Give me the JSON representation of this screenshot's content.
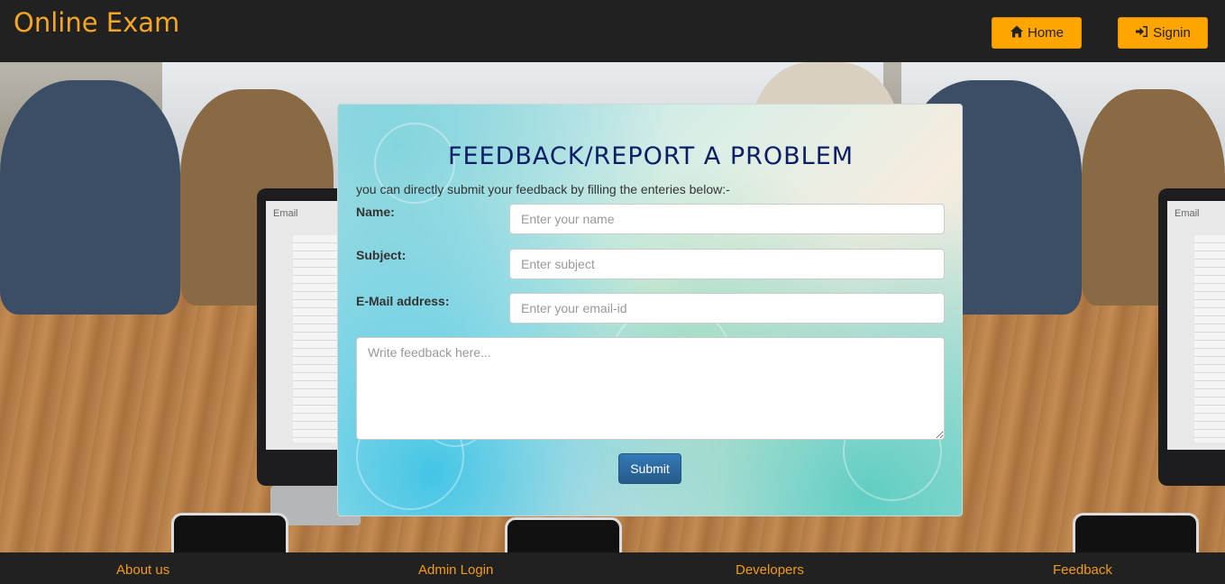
{
  "header": {
    "brand": "Online Exam",
    "home_label": "Home",
    "signin_label": "Signin"
  },
  "form": {
    "title": "FEEDBACK/REPORT A PROBLEM",
    "subtitle": "you can directly submit your feedback by filling the enteries below:-",
    "name_label": "Name:",
    "name_placeholder": "Enter your name",
    "subject_label": "Subject:",
    "subject_placeholder": "Enter subject",
    "email_label": "E-Mail address:",
    "email_placeholder": "Enter your email-id",
    "feedback_placeholder": "Write feedback here...",
    "submit_label": "Submit"
  },
  "background_image": {
    "laptop_screen_text": "Email"
  },
  "footer": {
    "links": [
      "About us",
      "Admin Login",
      "Developers",
      "Feedback"
    ]
  },
  "colors": {
    "bar_background": "#212121",
    "accent": "#f5a623",
    "button_orange": "#ffa500",
    "title_navy": "#0b1f66",
    "submit_blue": "#337ab7"
  },
  "icons": {
    "home": "home-icon",
    "signin": "sign-in-icon"
  }
}
